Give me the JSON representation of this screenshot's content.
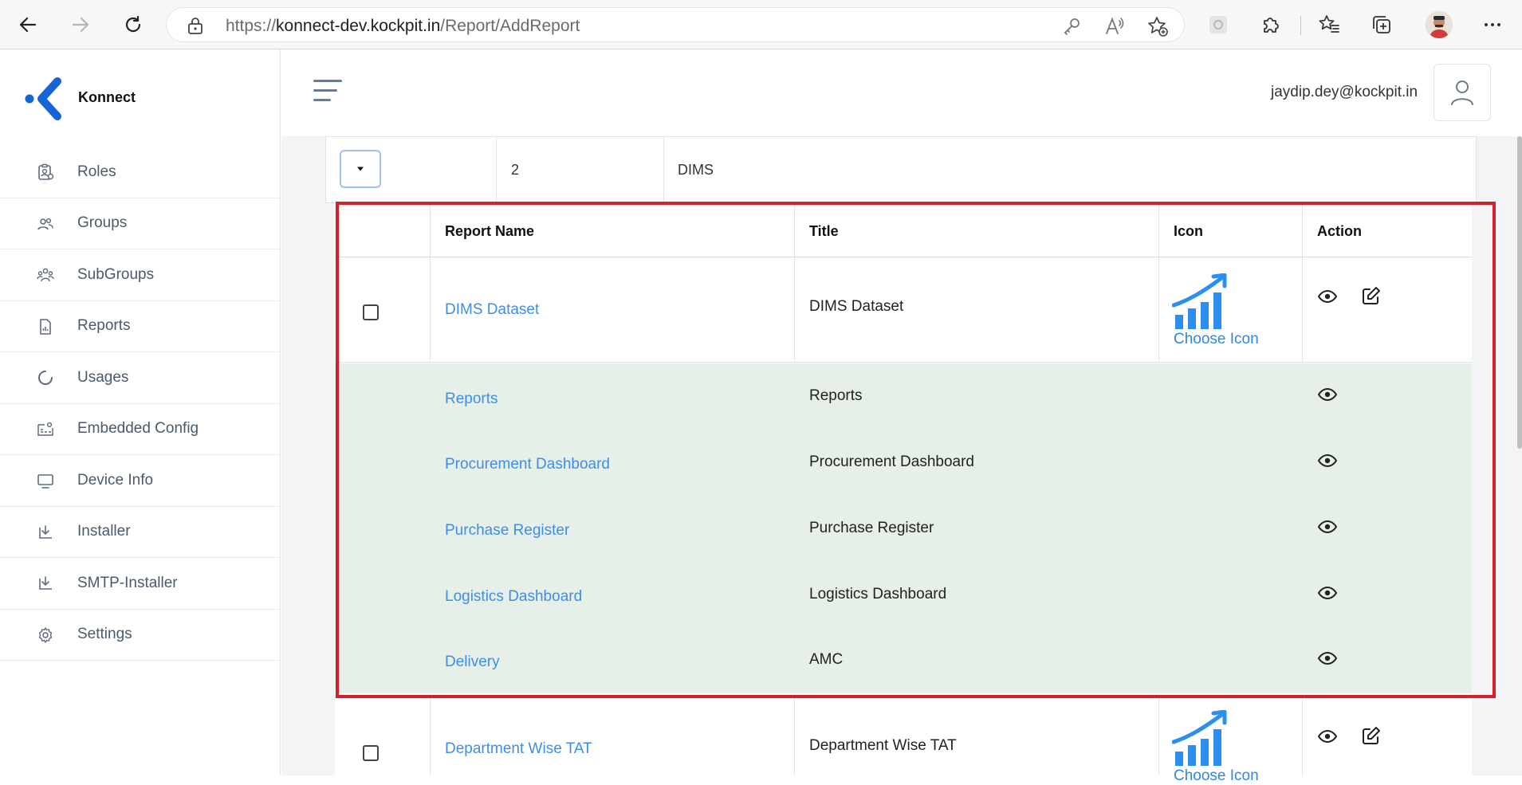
{
  "browser": {
    "url_prefix": "https://",
    "url_host": "konnect-dev.kockpit.in",
    "url_path": "/Report/AddReport"
  },
  "brand": {
    "name": "Konnect",
    "accent": "#1565d8"
  },
  "sidebar": {
    "items": [
      {
        "label": "Roles",
        "icon": "clipboard-user-icon"
      },
      {
        "label": "Groups",
        "icon": "users-icon"
      },
      {
        "label": "SubGroups",
        "icon": "team-icon"
      },
      {
        "label": "Reports",
        "icon": "report-file-icon"
      },
      {
        "label": "Usages",
        "icon": "spinner-icon"
      },
      {
        "label": "Embedded Config",
        "icon": "config-icon"
      },
      {
        "label": "Device Info",
        "icon": "monitor-icon"
      },
      {
        "label": "Installer",
        "icon": "download-icon"
      },
      {
        "label": "SMTP-Installer",
        "icon": "download-icon"
      },
      {
        "label": "Settings",
        "icon": "gear-icon"
      }
    ]
  },
  "header": {
    "user_email": "jaydip.dey@kockpit.in"
  },
  "group_row": {
    "id": "2",
    "name": "DIMS"
  },
  "table": {
    "columns": {
      "report_name": "Report Name",
      "title": "Title",
      "icon": "Icon",
      "action": "Action"
    },
    "choose_icon_label": "Choose Icon",
    "dataset_row": {
      "name": "DIMS Dataset",
      "title": "DIMS Dataset"
    },
    "sub_reports": [
      {
        "name": "Reports",
        "title": "Reports"
      },
      {
        "name": "Procurement Dashboard",
        "title": "Procurement Dashboard"
      },
      {
        "name": "Purchase Register",
        "title": "Purchase Register"
      },
      {
        "name": "Logistics Dashboard",
        "title": "Logistics Dashboard"
      },
      {
        "name": "Delivery",
        "title": "AMC"
      }
    ],
    "next_row": {
      "name": "Department Wise TAT",
      "title": "Department Wise TAT"
    }
  },
  "colors": {
    "link": "#3e8ee8",
    "highlight": "#d61f2b",
    "sub_row_bg": "#e7efe9"
  }
}
